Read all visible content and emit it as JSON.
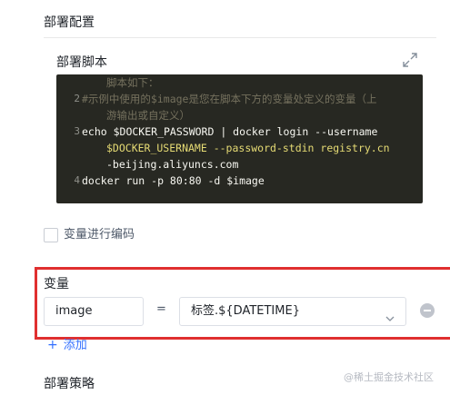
{
  "deploy_config": {
    "title": "部署配置"
  },
  "script_section": {
    "title": "部署脚本",
    "lines": [
      {
        "num": "",
        "text": "脚本如下："
      },
      {
        "num": "2",
        "text": "#示例中使用的$image是您在脚本下方的变量处定义的变量（上"
      },
      {
        "num": "",
        "text": "游输出或自定义）"
      },
      {
        "num": "3",
        "text": "echo $DOCKER_PASSWORD | docker login --username"
      },
      {
        "num": "",
        "text": "$DOCKER_USERNAME --password-stdin registry.cn"
      },
      {
        "num": "",
        "text": "-beijing.aliyuncs.com"
      },
      {
        "num": "4",
        "text": "docker run -p 80:80 -d $image"
      }
    ]
  },
  "encode_vars": {
    "label": "变量进行编码",
    "checked": false
  },
  "variables": {
    "title": "变量",
    "name_value": "image",
    "equals": "=",
    "value_selected": "标签.${DATETIME}",
    "add_label": "添加"
  },
  "strategy": {
    "title": "部署策略"
  },
  "watermark": "@稀土掘金技术社区",
  "icons": {
    "expand": "expand-icon",
    "chevron": "chevron-down-icon",
    "remove": "minus-circle-icon",
    "add": "plus-icon"
  },
  "colors": {
    "accent": "#3370ff",
    "highlight_frame": "#e02f2f",
    "code_bg": "#272822"
  }
}
